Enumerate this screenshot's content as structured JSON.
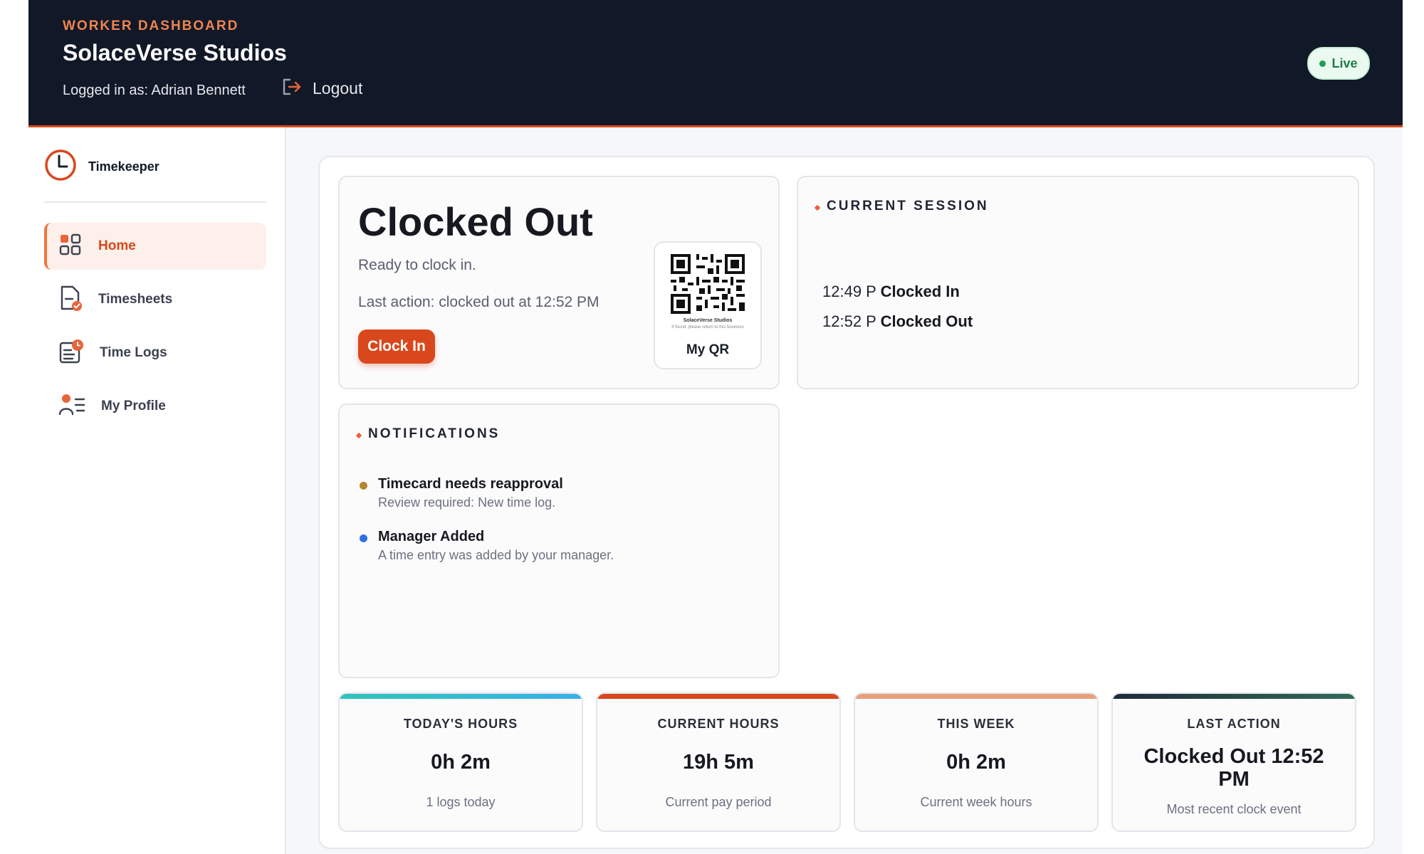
{
  "header": {
    "eyebrow": "WORKER DASHBOARD",
    "company": "SolaceVerse Studios",
    "logged_in": "Logged in as: Adrian Bennett",
    "logout_label": "Logout",
    "status_badge": "Live"
  },
  "sidebar": {
    "brand": "Timekeeper",
    "items": [
      {
        "label": "Home",
        "icon": "grid-icon",
        "active": true
      },
      {
        "label": "Timesheets",
        "icon": "document-check-icon"
      },
      {
        "label": "Time Logs",
        "icon": "log-clock-icon"
      },
      {
        "label": "My Profile",
        "icon": "user-list-icon"
      }
    ]
  },
  "status": {
    "title": "Clocked Out",
    "subtitle": "Ready to clock in.",
    "last_action": "Last action: clocked out at 12:52 PM",
    "button_label": "Clock In",
    "qr": {
      "caption_company": "SolaceVerse Studios",
      "caption_note": "If found, please return to this business",
      "label": "My QR"
    }
  },
  "session": {
    "heading": "CURRENT SESSION",
    "events": [
      {
        "time": "12:49 P",
        "event": "Clocked In"
      },
      {
        "time": "12:52 P",
        "event": "Clocked Out"
      }
    ]
  },
  "notifications": {
    "heading": "NOTIFICATIONS",
    "items": [
      {
        "title": "Timecard needs reapproval",
        "body": "Review required: New time log.",
        "color": "#b8862f"
      },
      {
        "title": "Manager Added",
        "body": "A time entry was added by your manager.",
        "color": "#2f6fe0"
      }
    ]
  },
  "stats": [
    {
      "label": "TODAY'S HOURS",
      "value": "0h 2m",
      "note": "1 logs today",
      "color": "#2fc4b8"
    },
    {
      "label": "CURRENT HOURS",
      "value": "19h 5m",
      "note": "Current pay period",
      "color": "#d9481c"
    },
    {
      "label": "THIS WEEK",
      "value": "0h 2m",
      "note": "Current week hours",
      "color": "#e8a07a"
    },
    {
      "label": "LAST ACTION",
      "value": "Clocked Out 12:52 PM",
      "note": "Most recent clock event",
      "color": "#1f2a37"
    }
  ],
  "colors": {
    "accent": "#d9481c",
    "header_bg": "#111827",
    "live_green": "#1e9f53"
  }
}
